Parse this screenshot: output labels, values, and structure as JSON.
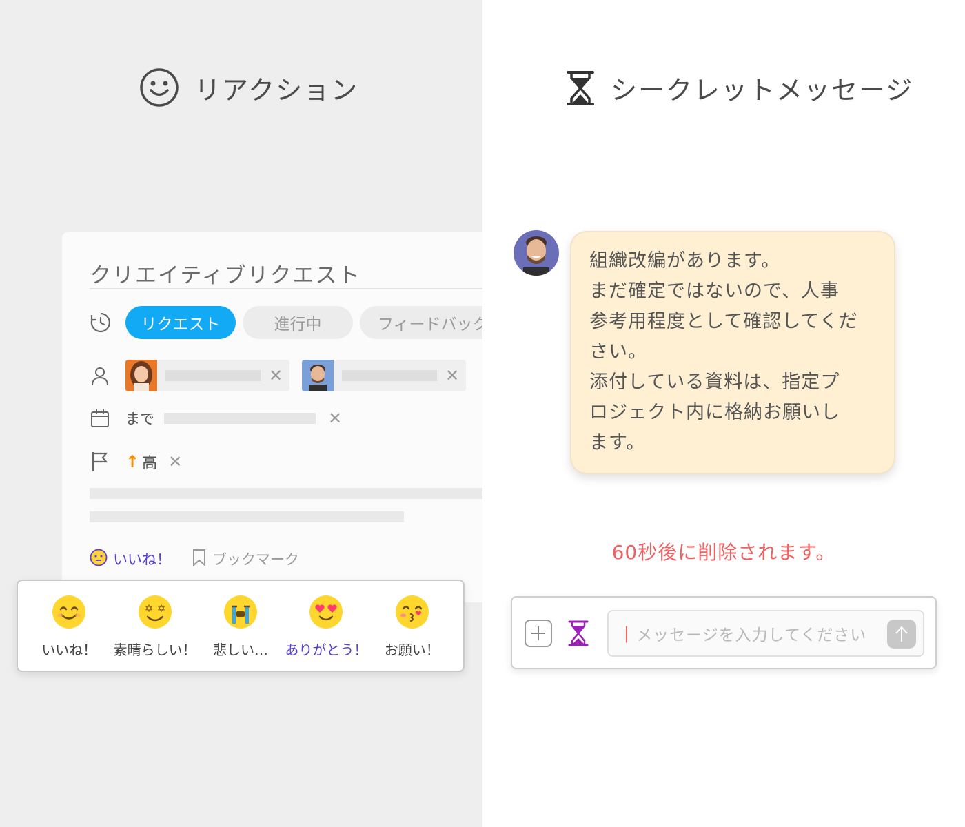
{
  "reaction_feature": {
    "title": "リアクション",
    "icon": "smiley-icon"
  },
  "secret_feature": {
    "title": "シークレットメッセージ",
    "icon": "hourglass-icon"
  },
  "task_card": {
    "title": "クリエイティブリクエスト",
    "statuses": [
      "リクエスト",
      "進行中",
      "フィードバック"
    ],
    "active_status": "リクエスト",
    "due_label": "まで",
    "priority_label": "高",
    "priority_icon": "arrow-up-icon",
    "like_label": "いいね！",
    "bookmark_label": "ブックマーク",
    "accent_color": "#12aaf5",
    "like_color": "#5a3fd6",
    "priority_color": "#ff8a00"
  },
  "reactions": [
    {
      "label": "いいね！",
      "icon": "smile-emoji-icon"
    },
    {
      "label": "素晴らしい！",
      "icon": "star-eyes-emoji-icon"
    },
    {
      "label": "悲しい…",
      "icon": "crying-emoji-icon"
    },
    {
      "label": "ありがとう！",
      "icon": "heart-eyes-emoji-icon",
      "selected": true
    },
    {
      "label": "お願い！",
      "icon": "kiss-emoji-icon"
    }
  ],
  "chat": {
    "message_lines": [
      "組織改編があります。",
      "まだ確定ではないので、人事",
      "参考用程度として確認してくだ",
      "さい。",
      "添付している資料は、指定プ",
      "ロジェクト内に格納お願いし",
      "ます。"
    ],
    "bubble_color": "#fff0d4",
    "timer_notice": "60秒後に削除されます。",
    "timer_color": "#f06060",
    "input_placeholder": "メッセージを入力してください"
  }
}
